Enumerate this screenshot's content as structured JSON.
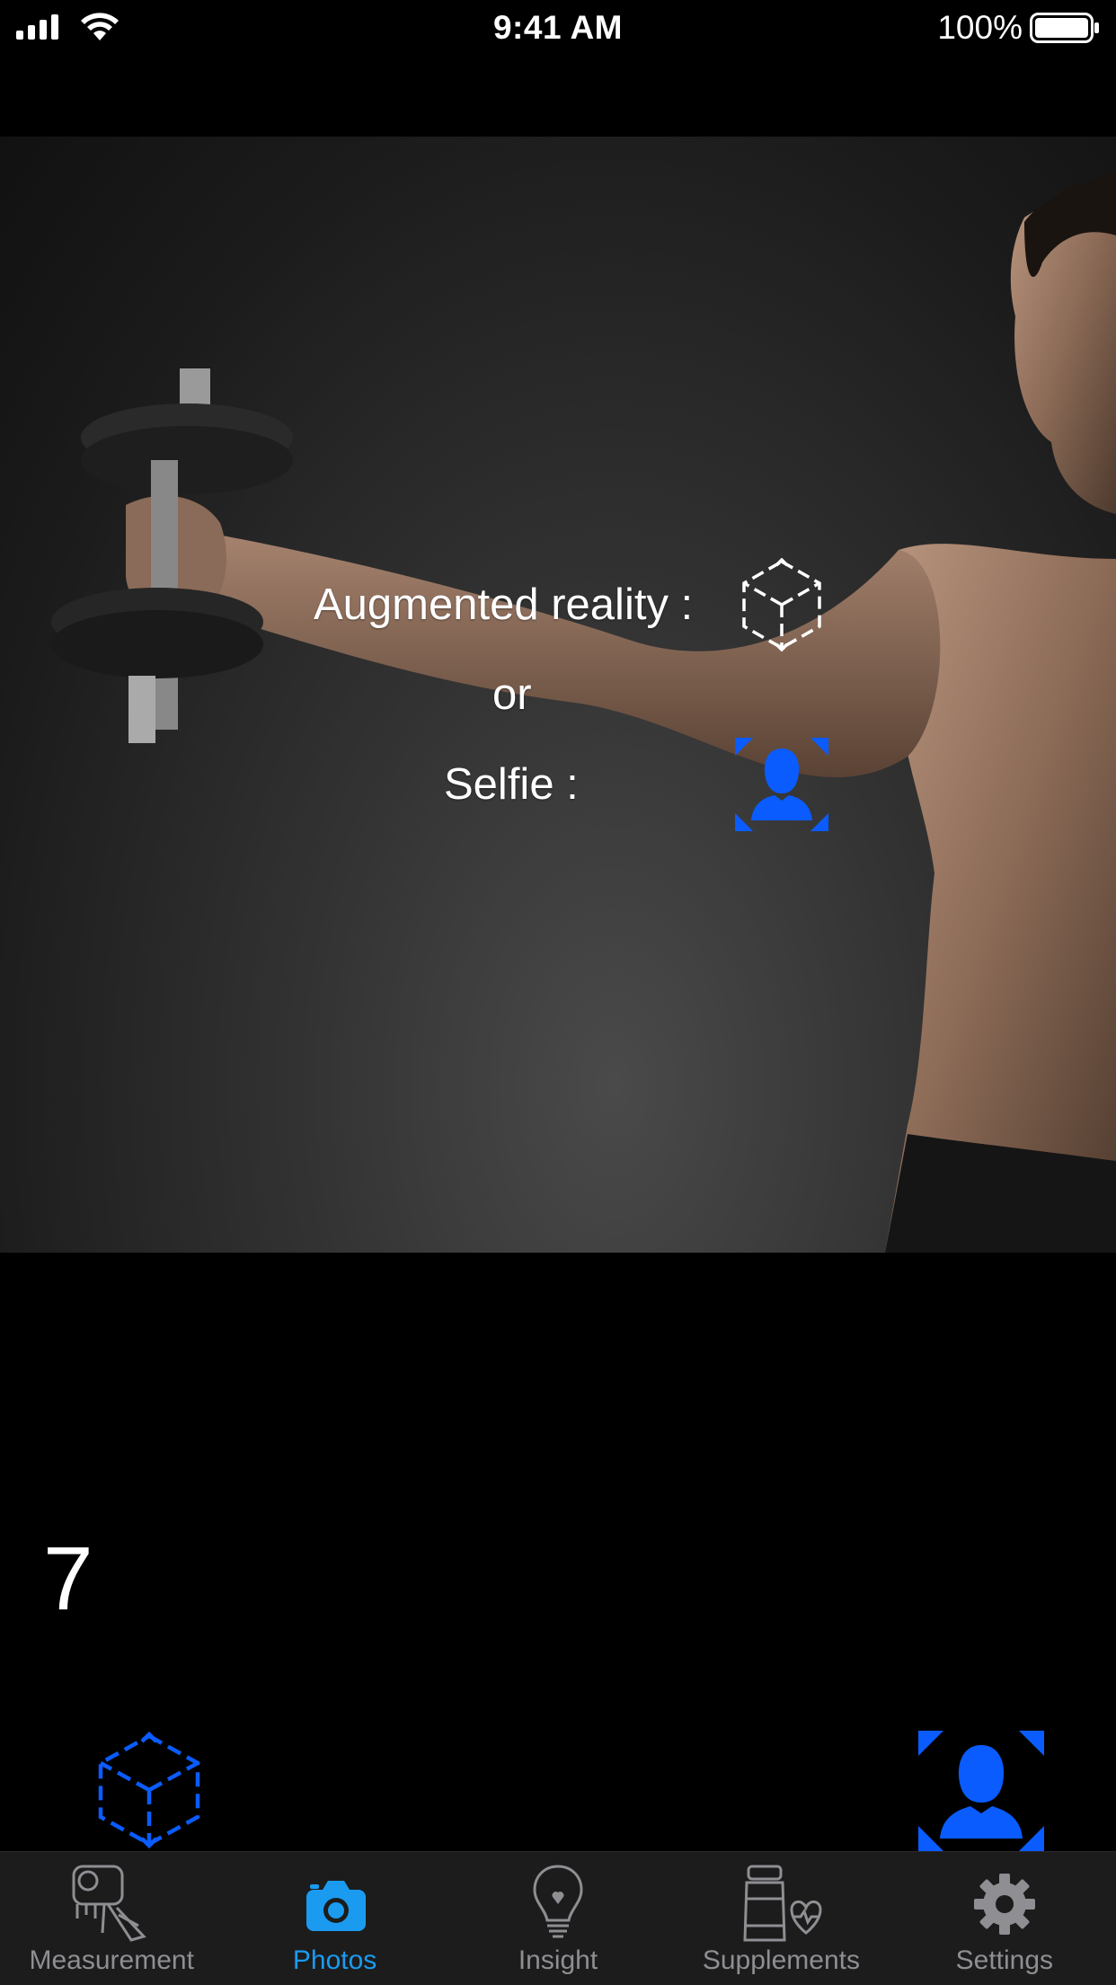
{
  "status_bar": {
    "time": "9:41 AM",
    "battery_percent": "100%",
    "signal_icon": "cellular-signal-icon",
    "wifi_icon": "wifi-icon",
    "battery_icon": "battery-icon"
  },
  "hero": {
    "ar_label": "Augmented reality :",
    "or_label": "or",
    "selfie_label": "Selfie :",
    "ar_icon": "ar-cube-icon",
    "selfie_icon": "selfie-person-icon"
  },
  "counter": "7",
  "controls": {
    "ar_button_icon": "ar-cube-icon",
    "selfie_button_icon": "selfie-person-icon"
  },
  "tabs": [
    {
      "label": "Measurement",
      "icon": "measurement-tape-icon",
      "active": false
    },
    {
      "label": "Photos",
      "icon": "camera-icon",
      "active": true
    },
    {
      "label": "Insight",
      "icon": "lightbulb-icon",
      "active": false
    },
    {
      "label": "Supplements",
      "icon": "supplements-bottle-icon",
      "active": false
    },
    {
      "label": "Settings",
      "icon": "gear-icon",
      "active": false
    }
  ],
  "colors": {
    "accent_blue": "#0a5cff",
    "tab_active": "#1a9bf0",
    "tab_inactive": "#8e8e93"
  }
}
